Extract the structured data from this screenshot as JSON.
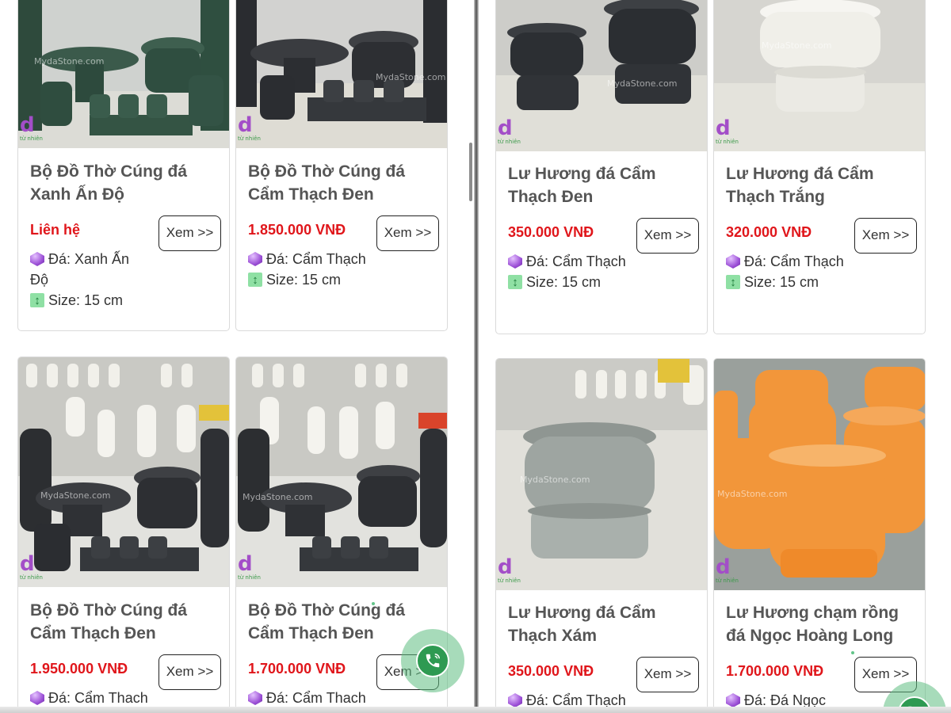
{
  "products": [
    {
      "title": "Bộ Đồ Thờ Cúng đá Xanh Ấn Độ",
      "price": "Liên hệ",
      "view": "Xem >>",
      "stone": "Đá: Xanh Ấn Độ",
      "size": "Size: 15 cm"
    },
    {
      "title": "Bộ Đồ Thờ Cúng đá Cẩm Thạch Đen",
      "price": "1.850.000 VNĐ",
      "view": "Xem >>",
      "stone": "Đá: Cẩm Thạch",
      "size": "Size: 15 cm"
    },
    {
      "title": "Bộ Đồ Thờ Cúng đá Cẩm Thạch Đen",
      "price": "1.950.000 VNĐ",
      "view": "Xem >>",
      "stone": "Đá: Cẩm Thach",
      "size": ""
    },
    {
      "title": "Bộ Đồ Thờ Cúng đá Cẩm Thạch Đen",
      "price": "1.700.000 VNĐ",
      "view": "Xem >>",
      "stone": "Đá: Cẩm Thach",
      "size": ""
    },
    {
      "title": "Lư Hương đá Cẩm Thạch Đen",
      "price": "350.000 VNĐ",
      "view": "Xem >>",
      "stone": "Đá: Cẩm Thạch",
      "size": "Size: 15 cm"
    },
    {
      "title": "Lư Hương đá Cẩm Thạch Trắng",
      "price": "320.000 VNĐ",
      "view": "Xem >>",
      "stone": "Đá: Cẩm Thạch",
      "size": "Size: 15 cm"
    },
    {
      "title": "Lư Hương đá Cẩm Thạch Xám",
      "price": "350.000 VNĐ",
      "view": "Xem >>",
      "stone": "Đá: Cẩm Thạch",
      "size": ""
    },
    {
      "title": "Lư Hương chạm rồng đá Ngọc Hoàng Long",
      "price": "1.700.000 VNĐ",
      "view": "Xem >>",
      "stone": "Đá: Đá Ngọc",
      "size": ""
    }
  ],
  "watermark": "MydaStone.com",
  "logo": {
    "mark": "d",
    "tagline": "từ nhiên"
  },
  "colors": {
    "price": "#e0161b",
    "title": "#555555",
    "stone_icon": "#9b4fd6",
    "size_icon": "#8fe0a4",
    "call_button": "#2e9a52"
  },
  "icons": {
    "stone": "gem-icon",
    "size": "height-icon",
    "call": "phone-call-icon"
  }
}
